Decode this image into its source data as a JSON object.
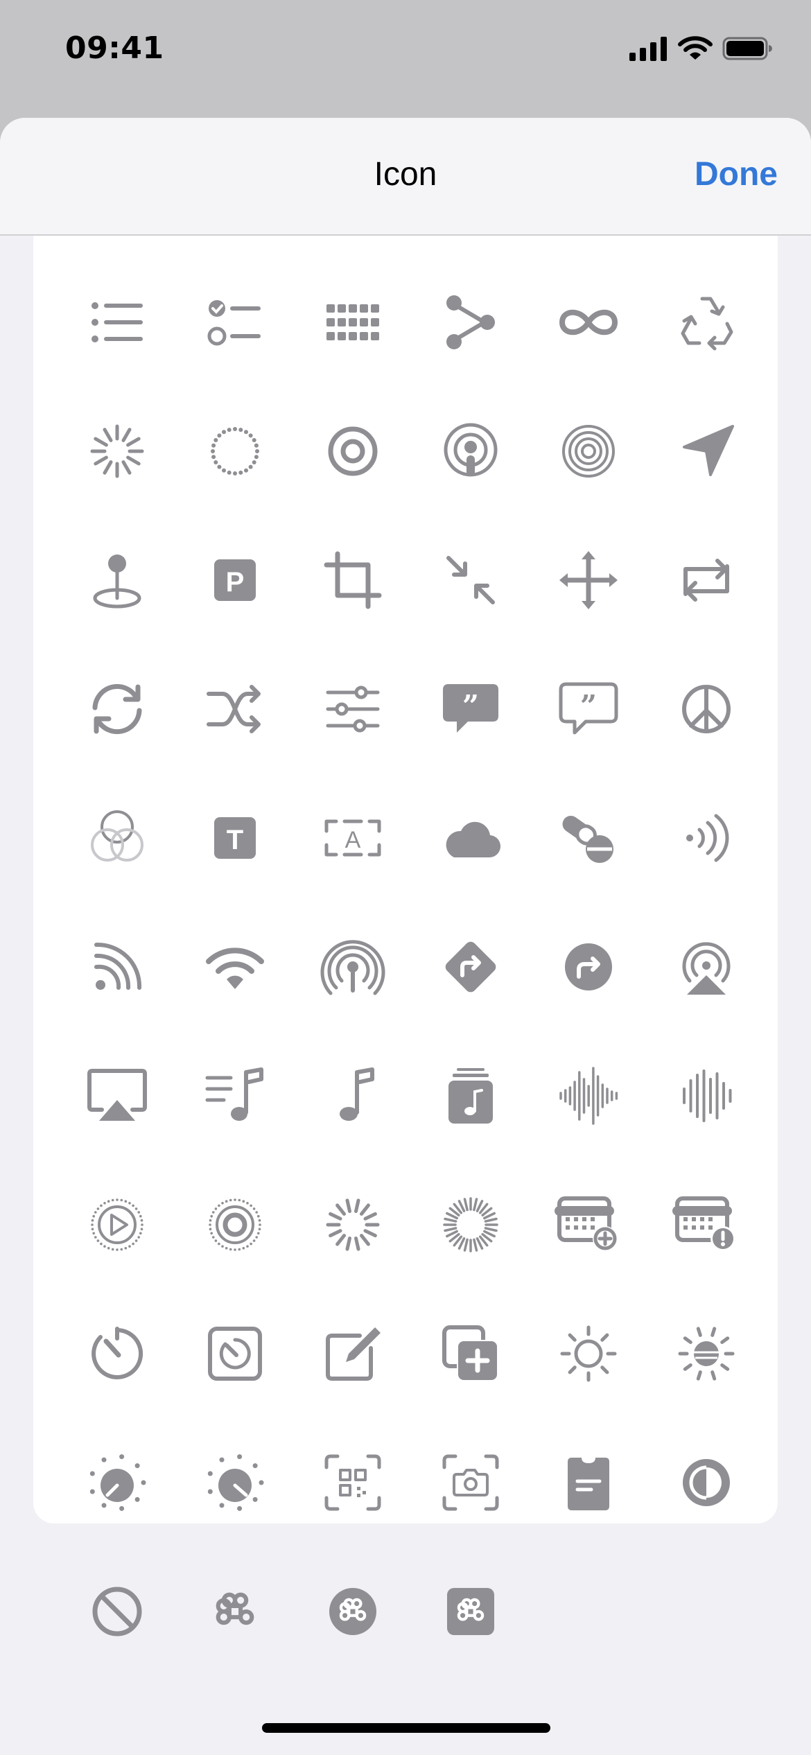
{
  "status_bar": {
    "time": "09:41"
  },
  "nav": {
    "title": "Icon",
    "done_label": "Done"
  },
  "colors": {
    "accent": "#3478d8",
    "icon": "#8e8e93"
  },
  "icons": [
    "list-bullet-icon",
    "checklist-icon",
    "grid-dots-icon",
    "share-nodes-icon",
    "infinity-icon",
    "recycle-icon",
    "rays-icon",
    "dotted-circle-icon",
    "target-icon",
    "podcast-icon",
    "concentric-circles-icon",
    "location-arrow-icon",
    "map-pin-icon",
    "parking-sign-icon",
    "crop-icon",
    "arrows-inward-icon",
    "move-arrows-icon",
    "repeat-icon",
    "sync-arrows-icon",
    "shuffle-icon",
    "sliders-icon",
    "quote-bubble-filled-icon",
    "quote-bubble-outline-icon",
    "peace-icon",
    "color-circles-icon",
    "text-square-icon",
    "text-frame-icon",
    "cloud-icon",
    "pills-icon",
    "contactless-icon",
    "feed-icon",
    "wifi-icon",
    "broadcast-icon",
    "diamond-arrow-icon",
    "circle-arrow-icon",
    "airplay-audio-icon",
    "airplay-video-icon",
    "music-list-icon",
    "music-note-icon",
    "music-stack-icon",
    "waveform-icon",
    "audio-bars-icon",
    "play-dotted-circle-icon",
    "record-dotted-circle-icon",
    "loading-spinner-icon",
    "loading-spinner-dense-icon",
    "calendar-add-icon",
    "calendar-alert-icon",
    "timer-icon",
    "timer-square-icon",
    "compose-icon",
    "copy-add-icon",
    "sun-moon-icon",
    "sun-horizon-icon",
    "dial-low-icon",
    "dial-high-icon",
    "qr-scan-icon",
    "camera-scan-icon",
    "clipboard-icon",
    "contrast-icon",
    "prohibited-icon",
    "command-icon",
    "command-circle-icon",
    "command-square-icon"
  ]
}
